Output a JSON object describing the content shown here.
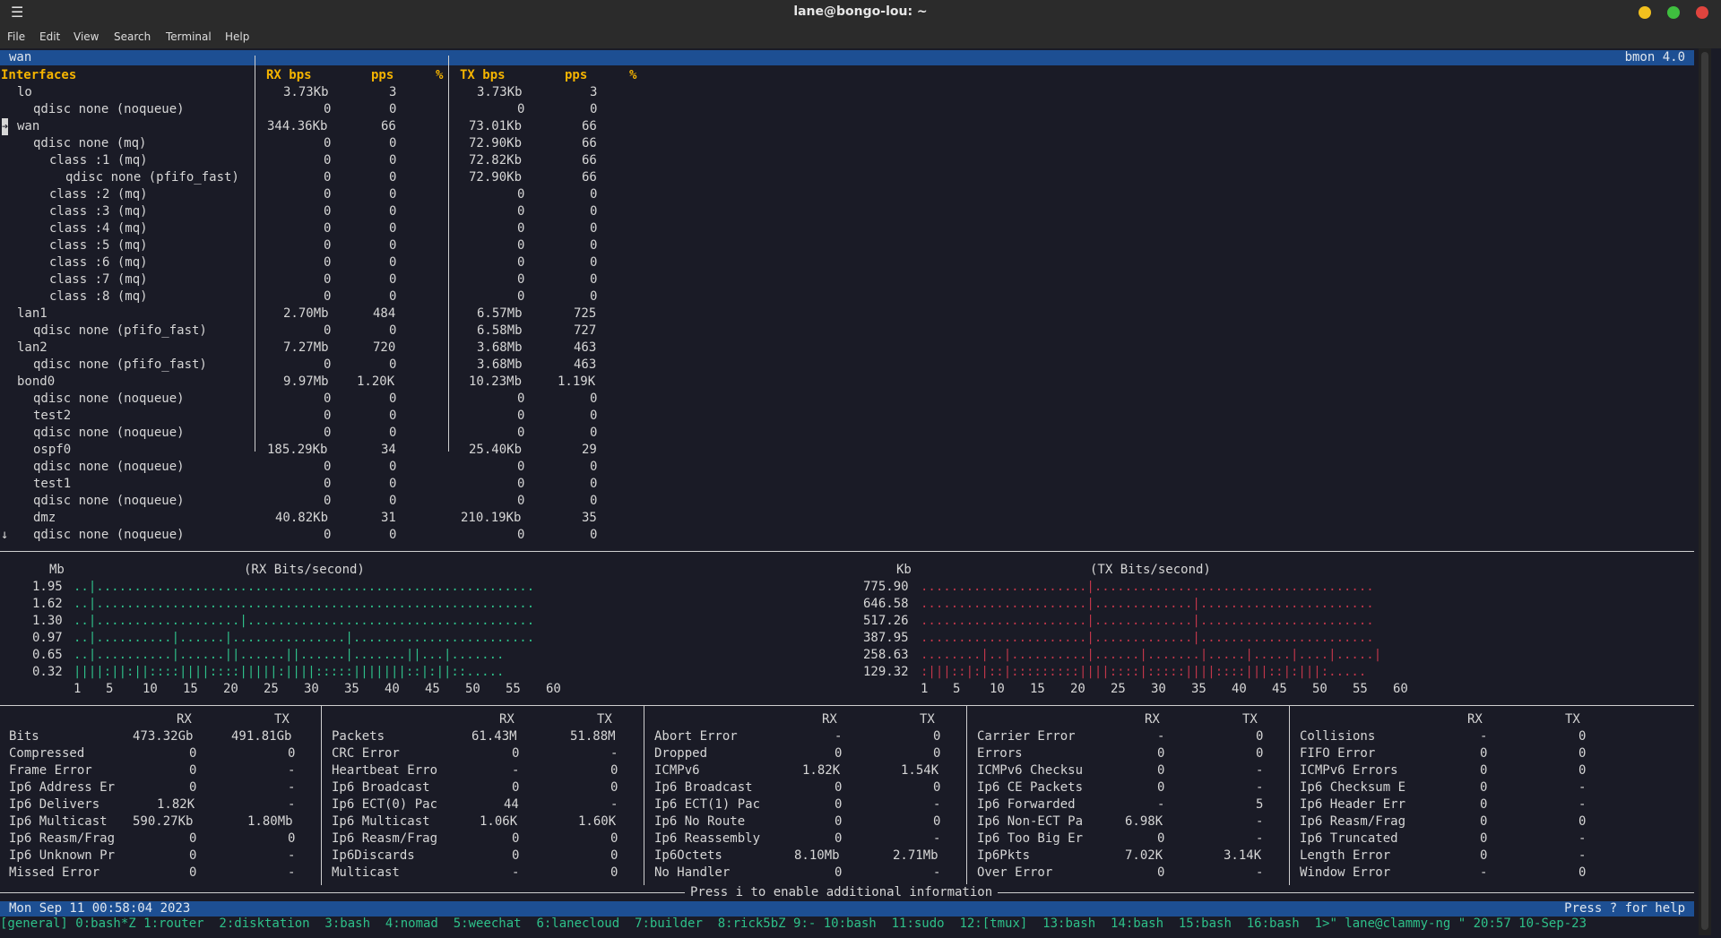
{
  "window": {
    "title": "lane@bongo-lou: ~",
    "menu": [
      "File",
      "Edit",
      "View",
      "Search",
      "Terminal",
      "Help"
    ]
  },
  "bmon": {
    "tab": "wan",
    "version": "bmon 4.0",
    "headers": [
      "Interfaces",
      "RX bps",
      "pps",
      "%",
      "TX bps",
      "pps",
      "%"
    ],
    "rows": [
      {
        "ind": 1,
        "name": "lo",
        "rx": "3.73Kb",
        "rpps": "3",
        "tx": "3.73Kb",
        "tpps": "3"
      },
      {
        "ind": 2,
        "name": "qdisc none (noqueue)",
        "rx": "0",
        "rpps": "0",
        "tx": "0",
        "tpps": "0"
      },
      {
        "ind": 1,
        "name": "wan",
        "rx": "344.36Kb",
        "rpps": "66",
        "tx": "73.01Kb",
        "tpps": "66",
        "sel": true
      },
      {
        "ind": 2,
        "name": "qdisc none (mq)",
        "rx": "0",
        "rpps": "0",
        "tx": "72.90Kb",
        "tpps": "66"
      },
      {
        "ind": 3,
        "name": "class :1 (mq)",
        "rx": "0",
        "rpps": "0",
        "tx": "72.82Kb",
        "tpps": "66"
      },
      {
        "ind": 4,
        "name": "qdisc none (pfifo_fast)",
        "rx": "0",
        "rpps": "0",
        "tx": "72.90Kb",
        "tpps": "66"
      },
      {
        "ind": 3,
        "name": "class :2 (mq)",
        "rx": "0",
        "rpps": "0",
        "tx": "0",
        "tpps": "0"
      },
      {
        "ind": 3,
        "name": "class :3 (mq)",
        "rx": "0",
        "rpps": "0",
        "tx": "0",
        "tpps": "0"
      },
      {
        "ind": 3,
        "name": "class :4 (mq)",
        "rx": "0",
        "rpps": "0",
        "tx": "0",
        "tpps": "0"
      },
      {
        "ind": 3,
        "name": "class :5 (mq)",
        "rx": "0",
        "rpps": "0",
        "tx": "0",
        "tpps": "0"
      },
      {
        "ind": 3,
        "name": "class :6 (mq)",
        "rx": "0",
        "rpps": "0",
        "tx": "0",
        "tpps": "0"
      },
      {
        "ind": 3,
        "name": "class :7 (mq)",
        "rx": "0",
        "rpps": "0",
        "tx": "0",
        "tpps": "0"
      },
      {
        "ind": 3,
        "name": "class :8 (mq)",
        "rx": "0",
        "rpps": "0",
        "tx": "0",
        "tpps": "0"
      },
      {
        "ind": 1,
        "name": "lan1",
        "rx": "2.70Mb",
        "rpps": "484",
        "tx": "6.57Mb",
        "tpps": "725"
      },
      {
        "ind": 2,
        "name": "qdisc none (pfifo_fast)",
        "rx": "0",
        "rpps": "0",
        "tx": "6.58Mb",
        "tpps": "727"
      },
      {
        "ind": 1,
        "name": "lan2",
        "rx": "7.27Mb",
        "rpps": "720",
        "tx": "3.68Mb",
        "tpps": "463"
      },
      {
        "ind": 2,
        "name": "qdisc none (pfifo_fast)",
        "rx": "0",
        "rpps": "0",
        "tx": "3.68Mb",
        "tpps": "463"
      },
      {
        "ind": 1,
        "name": "bond0",
        "rx": "9.97Mb",
        "rpps": "1.20K",
        "tx": "10.23Mb",
        "tpps": "1.19K"
      },
      {
        "ind": 2,
        "name": "qdisc none (noqueue)",
        "rx": "0",
        "rpps": "0",
        "tx": "0",
        "tpps": "0"
      },
      {
        "ind": 2,
        "name": "test2",
        "rx": "0",
        "rpps": "0",
        "tx": "0",
        "tpps": "0"
      },
      {
        "ind": 2,
        "name": "qdisc none (noqueue)",
        "rx": "0",
        "rpps": "0",
        "tx": "0",
        "tpps": "0"
      },
      {
        "ind": 2,
        "name": "ospf0",
        "rx": "185.29Kb",
        "rpps": "34",
        "tx": "25.40Kb",
        "tpps": "29"
      },
      {
        "ind": 2,
        "name": "qdisc none (noqueue)",
        "rx": "0",
        "rpps": "0",
        "tx": "0",
        "tpps": "0"
      },
      {
        "ind": 2,
        "name": "test1",
        "rx": "0",
        "rpps": "0",
        "tx": "0",
        "tpps": "0"
      },
      {
        "ind": 2,
        "name": "qdisc none (noqueue)",
        "rx": "0",
        "rpps": "0",
        "tx": "0",
        "tpps": "0"
      },
      {
        "ind": 2,
        "name": "dmz",
        "rx": "40.82Kb",
        "rpps": "31",
        "tx": "210.19Kb",
        "tpps": "35"
      },
      {
        "ind": 2,
        "name": "qdisc none (noqueue)",
        "rx": "0",
        "rpps": "0",
        "tx": "0",
        "tpps": "0",
        "arrow": true
      }
    ],
    "graphs": {
      "rx": {
        "title": "(RX Bits/second)",
        "unit": "Mb",
        "yticks": [
          "1.95",
          "1.62",
          "1.30",
          "0.97",
          "0.65",
          "0.32"
        ],
        "lines": [
          "..|..........................................................",
          "..|..........................................................",
          "..|...................|......................................",
          "..|..........|......|...............|........................",
          "..|..........|......||......||......|.......||...|.......",
          "||||:||:||::::||||::::|||||:||||:::::|||||||::|:||::....."
        ],
        "xticks": [
          "1",
          "5",
          "10",
          "15",
          "20",
          "25",
          "30",
          "35",
          "40",
          "45",
          "50",
          "55",
          "60"
        ]
      },
      "tx": {
        "title": "(TX Bits/second)",
        "unit": "Kb",
        "yticks": [
          "775.90",
          "646.58",
          "517.26",
          "387.95",
          "258.63",
          "129.32"
        ],
        "lines": [
          "......................|.....................................",
          "......................|.............|.......................",
          "......................|.............|.......................",
          "......................|.............|.......................",
          "........|..|..........|......|.......|.....|.....|....|.....|",
          ":|||::|:|::|:::::::::||||::::|:::::||||::::|||::|:|||:....."
        ],
        "xticks": [
          "1",
          "5",
          "10",
          "15",
          "20",
          "25",
          "30",
          "35",
          "40",
          "45",
          "50",
          "55",
          "60"
        ]
      }
    },
    "stats": [
      {
        "rows": [
          [
            "Bits",
            "473.32Gb",
            "491.81Gb"
          ],
          [
            "Compressed",
            "0",
            "0"
          ],
          [
            "Frame Error",
            "0",
            "-"
          ],
          [
            "Ip6 Address Er",
            "0",
            "-"
          ],
          [
            "Ip6 Delivers",
            "1.82K",
            "-"
          ],
          [
            "Ip6 Multicast",
            "590.27Kb",
            "1.80Mb"
          ],
          [
            "Ip6 Reasm/Frag",
            "0",
            "0"
          ],
          [
            "Ip6 Unknown Pr",
            "0",
            "-"
          ],
          [
            "Missed Error",
            "0",
            "-"
          ]
        ]
      },
      {
        "rows": [
          [
            "Packets",
            "61.43M",
            "51.88M"
          ],
          [
            "CRC Error",
            "0",
            "-"
          ],
          [
            "Heartbeat Erro",
            "-",
            "0"
          ],
          [
            "Ip6 Broadcast",
            "0",
            "0"
          ],
          [
            "Ip6 ECT(0) Pac",
            "44",
            "-"
          ],
          [
            "Ip6 Multicast",
            "1.06K",
            "1.60K"
          ],
          [
            "Ip6 Reasm/Frag",
            "0",
            "0"
          ],
          [
            "Ip6Discards",
            "0",
            "0"
          ],
          [
            "Multicast",
            "-",
            "0"
          ]
        ]
      },
      {
        "rows": [
          [
            "Abort Error",
            "-",
            "0"
          ],
          [
            "Dropped",
            "0",
            "0"
          ],
          [
            "ICMPv6",
            "1.82K",
            "1.54K"
          ],
          [
            "Ip6 Broadcast",
            "0",
            "0"
          ],
          [
            "Ip6 ECT(1) Pac",
            "0",
            "-"
          ],
          [
            "Ip6 No Route",
            "0",
            "0"
          ],
          [
            "Ip6 Reassembly",
            "0",
            "-"
          ],
          [
            "Ip6Octets",
            "8.10Mb",
            "2.71Mb"
          ],
          [
            "No Handler",
            "0",
            "-"
          ]
        ]
      },
      {
        "rows": [
          [
            "Carrier Error",
            "-",
            "0"
          ],
          [
            "Errors",
            "0",
            "0"
          ],
          [
            "ICMPv6 Checksu",
            "0",
            "-"
          ],
          [
            "Ip6 CE Packets",
            "0",
            "-"
          ],
          [
            "Ip6 Forwarded",
            "-",
            "5"
          ],
          [
            "Ip6 Non-ECT Pa",
            "6.98K",
            "-"
          ],
          [
            "Ip6 Too Big Er",
            "0",
            "-"
          ],
          [
            "Ip6Pkts",
            "7.02K",
            "3.14K"
          ],
          [
            "Over Error",
            "0",
            "-"
          ]
        ]
      },
      {
        "rows": [
          [
            "Collisions",
            "-",
            "0"
          ],
          [
            "FIFO Error",
            "0",
            "0"
          ],
          [
            "ICMPv6 Errors",
            "0",
            "0"
          ],
          [
            "Ip6 Checksum E",
            "0",
            "-"
          ],
          [
            "Ip6 Header Err",
            "0",
            "-"
          ],
          [
            "Ip6 Reasm/Frag",
            "0",
            "0"
          ],
          [
            "Ip6 Truncated",
            "0",
            "-"
          ],
          [
            "Length Error",
            "0",
            "-"
          ],
          [
            "Window Error",
            "-",
            "0"
          ]
        ]
      }
    ],
    "stats_rx": "RX",
    "stats_tx": "TX",
    "hint": "Press i to enable additional information",
    "status_left": "Mon Sep 11 00:58:04 2023",
    "status_right": "Press ? for help"
  },
  "tmux": "[general] 0:bash*Z 1:router  2:disktation  3:bash  4:nomad  5:weechat  6:lanecloud  7:builder  8:rick5bZ 9:- 10:bash  11:sudo  12:[tmux]  13:bash  14:bash  15:bash  16:bash  1>\" lane@clammy-ng \" 20:57 10-Sep-23",
  "colors": {
    "accent": "#1d4f93",
    "header": "#f5b400",
    "rx_graph": "#2ec08a",
    "tx_graph": "#c1364a"
  }
}
